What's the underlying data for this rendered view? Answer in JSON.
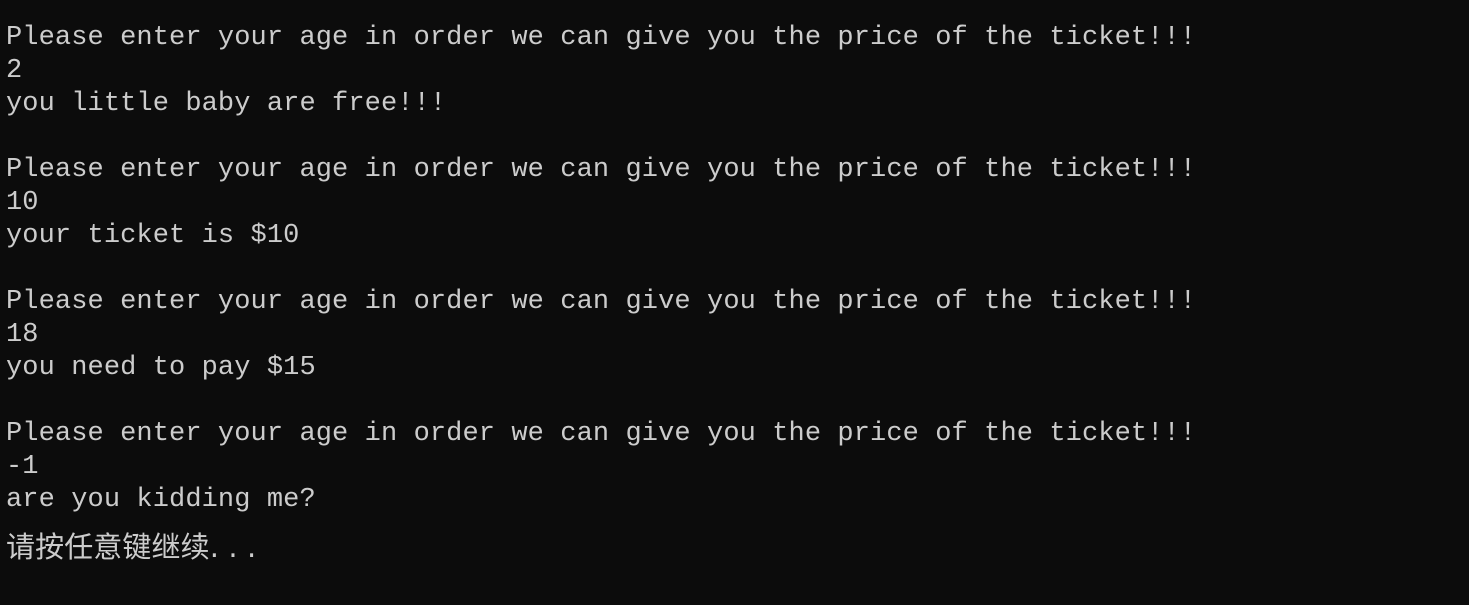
{
  "console": {
    "lines": [
      "Please enter your age in order we can give you the price of the ticket!!!",
      "2",
      "you little baby are free!!!",
      "",
      "Please enter your age in order we can give you the price of the ticket!!!",
      "10",
      "your ticket is $10",
      "",
      "Please enter your age in order we can give you the price of the ticket!!!",
      "18",
      "you need to pay $15",
      "",
      "Please enter your age in order we can give you the price of the ticket!!!",
      "-1",
      "are you kidding me?",
      "请按任意键继续. . ."
    ]
  },
  "colors": {
    "background": "#0c0c0c",
    "text": "#cccccc"
  }
}
